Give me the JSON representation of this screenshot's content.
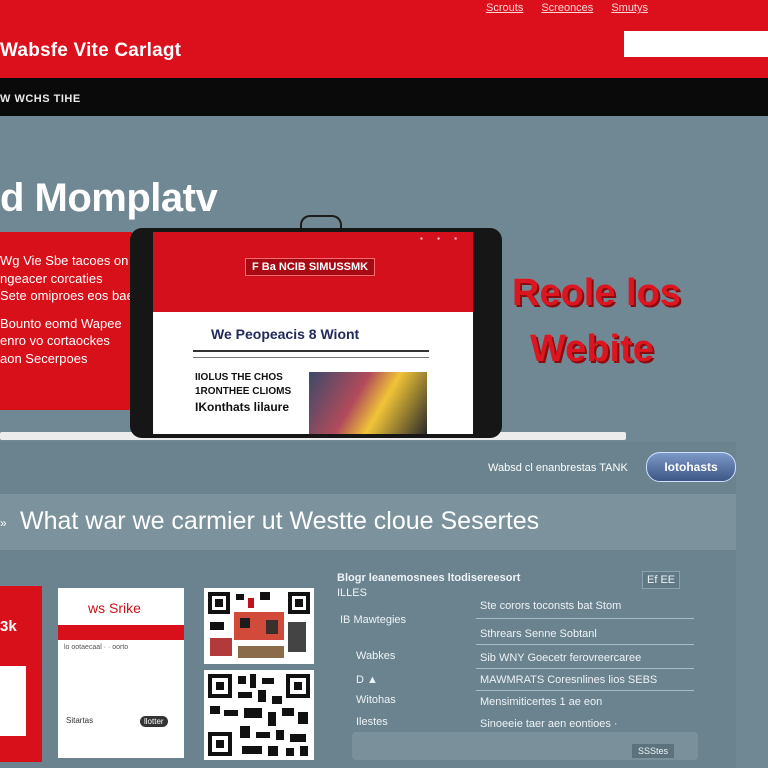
{
  "header": {
    "top_links": [
      "Scrouts",
      "Screonces",
      "Smutys"
    ],
    "brand": "Wabsfe Vite Carlagt",
    "search_placeholder": ""
  },
  "nav": {
    "text": "W WCHS TIHE"
  },
  "hero": {
    "title": "d Momplatv",
    "box_lines": [
      "Wg Vie Sbe tacoes on",
      "ngeacer corcaties",
      "Sete omiproes eos bae",
      "Bounto eomd Wapee",
      "enro vo cortaockes",
      "aon Secerpoes"
    ],
    "side_title_line1": "Reole los",
    "side_title_line2": "Webite"
  },
  "screen": {
    "banner": "F Ba NCIB SIMUSSMK",
    "heading": "We Peopeacis 8 Wiont",
    "text1": "IIOLUS THE CHOS",
    "text2": "1RONTHEE CLIOMS",
    "text3": "IKonthats lilaure",
    "dots": "▪ ▪ ▪"
  },
  "strip": {
    "text": "Wabsd cl enanbrestas TANK",
    "badge": "Iotohasts"
  },
  "services": {
    "bullet": "»",
    "title": "What war we carmier ut  Westte cloue Sesertes"
  },
  "cards": {
    "red_text": "3k",
    "white_title": "ws Srike",
    "white_small": "lo ootaecaal · · oorto",
    "white_foot1": "Sitartas",
    "white_foot2": "llotter"
  },
  "panel": {
    "head": "Blogr leanemosnees ltodisereesort",
    "sub": "ILLES",
    "tag": "Ef EE",
    "rows": [
      {
        "left": "IB   Mawtegies",
        "right": "Ste corors toconsts bat Stom"
      },
      {
        "left": "",
        "right": "Sthrears Senne Sobtanl"
      },
      {
        "left": "Wabkes",
        "right": "Sib WNY Goecetr ferovreercaree"
      },
      {
        "left": "D  ▲",
        "right": "MAWMRATS Coresnlines lios SEBS"
      },
      {
        "left": "Witohas",
        "right": "Mensimiticertes 1 ae eon"
      },
      {
        "left": "Ilestes",
        "right": "Sinoeeie taer aen eontioes ·"
      }
    ],
    "bottom_tag": "SSStes"
  }
}
